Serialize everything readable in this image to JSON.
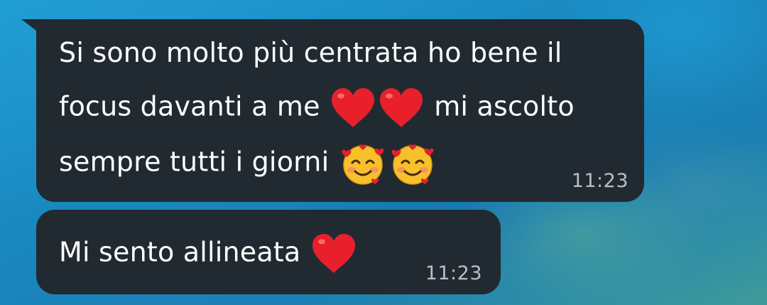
{
  "messages": [
    {
      "lines": [
        {
          "text": "Si sono molto più centrata ho bene il"
        },
        {
          "before": "focus davanti a me",
          "emojis": [
            "red-heart",
            "red-heart"
          ],
          "after": "mi ascolto"
        },
        {
          "before": "sempre tutti i giorni",
          "emojis": [
            "smiling-face-with-hearts",
            "smiling-face-with-hearts"
          ],
          "after": ""
        }
      ],
      "time": "11:23"
    },
    {
      "lines": [
        {
          "before": "Mi sento allineata",
          "emojis": [
            "red-heart"
          ],
          "after": ""
        }
      ],
      "time": "11:23"
    }
  ],
  "colors": {
    "bubble": "#222a31",
    "text": "#ffffff",
    "time": "#b8c0c7",
    "heart": "#e8202c",
    "wallpaper": "#1e8fbf"
  }
}
